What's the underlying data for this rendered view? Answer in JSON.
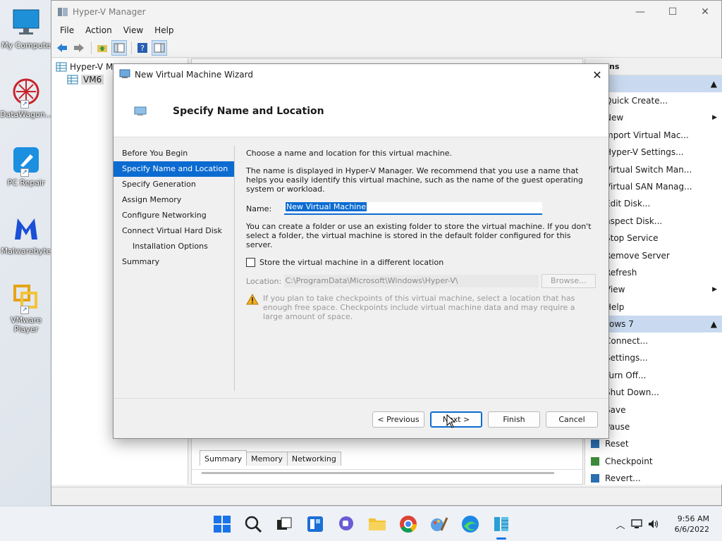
{
  "desktop": {
    "icons": [
      {
        "label": "My Compute",
        "icon": "monitor-icon"
      },
      {
        "label": "DataWagon...",
        "icon": "datawagon-icon"
      },
      {
        "label": "PC Repair",
        "icon": "pc-repair-icon"
      },
      {
        "label": "Malwarebyte",
        "icon": "malwarebytes-icon"
      },
      {
        "label": "VMware Player",
        "icon": "vmware-icon"
      }
    ]
  },
  "main_window": {
    "title": "Hyper-V Manager",
    "menu": [
      "File",
      "Action",
      "View",
      "Help"
    ],
    "tree": {
      "root": "Hyper-V Ma",
      "child": "VM6"
    },
    "bottom_tabs": [
      "Summary",
      "Memory",
      "Networking"
    ],
    "actions": {
      "header": "ns",
      "group1_items": [
        {
          "label": "Quick Create...",
          "submenu": false
        },
        {
          "label": "New",
          "submenu": true
        },
        {
          "label": "mport Virtual Mac...",
          "submenu": false
        },
        {
          "label": "Hyper-V Settings...",
          "submenu": false
        },
        {
          "label": "Virtual Switch Man...",
          "submenu": false
        },
        {
          "label": "Virtual SAN Manag...",
          "submenu": false
        },
        {
          "label": "Edit Disk...",
          "submenu": false
        },
        {
          "label": "nspect Disk...",
          "submenu": false
        },
        {
          "label": "Stop Service",
          "submenu": false
        },
        {
          "label": "Remove Server",
          "submenu": false
        },
        {
          "label": "Refresh",
          "submenu": false
        },
        {
          "label": "View",
          "submenu": true
        },
        {
          "label": "Help",
          "submenu": false
        }
      ],
      "group2_label": "ows 7",
      "group2_items": [
        {
          "label": "Connect..."
        },
        {
          "label": "Settings..."
        },
        {
          "label": "Turn Off..."
        },
        {
          "label": "Shut Down..."
        },
        {
          "label": "Save"
        },
        {
          "label": "Pause"
        },
        {
          "label": "Reset"
        },
        {
          "label": "Checkpoint"
        },
        {
          "label": "Revert..."
        }
      ]
    }
  },
  "wizard": {
    "title": "New Virtual Machine Wizard",
    "header": "Specify Name and Location",
    "nav": [
      {
        "label": "Before You Begin",
        "active": false,
        "sub": false
      },
      {
        "label": "Specify Name and Location",
        "active": true,
        "sub": false
      },
      {
        "label": "Specify Generation",
        "active": false,
        "sub": false
      },
      {
        "label": "Assign Memory",
        "active": false,
        "sub": false
      },
      {
        "label": "Configure Networking",
        "active": false,
        "sub": false
      },
      {
        "label": "Connect Virtual Hard Disk",
        "active": false,
        "sub": false
      },
      {
        "label": "Installation Options",
        "active": false,
        "sub": true
      },
      {
        "label": "Summary",
        "active": false,
        "sub": false
      }
    ],
    "intro": "Choose a name and location for this virtual machine.",
    "name_description": "The name is displayed in Hyper-V Manager. We recommend that you use a name that helps you easily identify this virtual machine, such as the name of the guest operating system or workload.",
    "name_label": "Name:",
    "name_value": "New Virtual Machine",
    "folder_description": "You can create a folder or use an existing folder to store the virtual machine. If you don't select a folder, the virtual machine is stored in the default folder configured for this server.",
    "store_checkbox_label": "Store the virtual machine in a different location",
    "location_label": "Location:",
    "location_value": "C:\\ProgramData\\Microsoft\\Windows\\Hyper-V\\",
    "browse_label": "Browse...",
    "warning_text": "If you plan to take checkpoints of this virtual machine, select a location that has enough free space. Checkpoints include virtual machine data and may require a large amount of space.",
    "buttons": {
      "previous": "< Previous",
      "next": "Next >",
      "finish": "Finish",
      "cancel": "Cancel"
    }
  },
  "taskbar": {
    "time": "9:56 AM",
    "date": "6/6/2022"
  },
  "colors": {
    "accent": "#0b6bd1",
    "actions_group_bg": "#c9daf0"
  }
}
